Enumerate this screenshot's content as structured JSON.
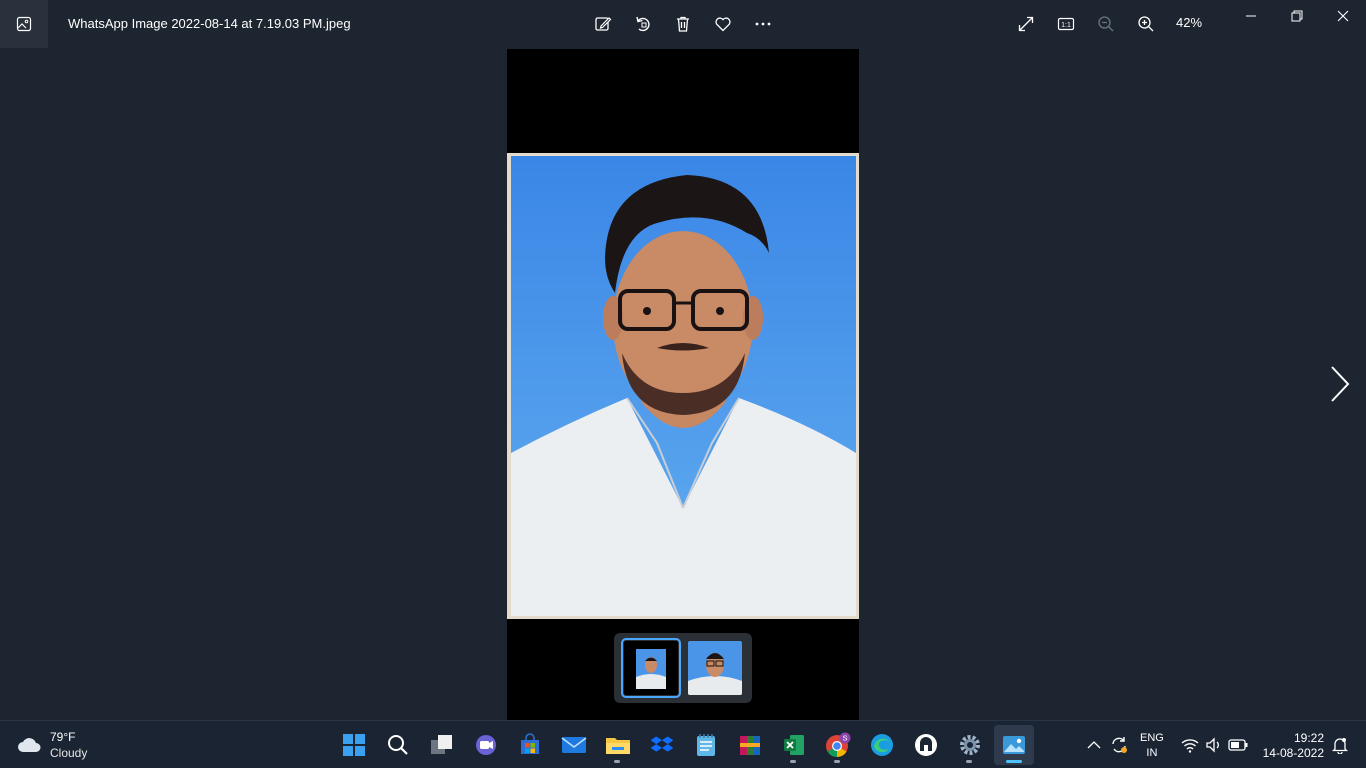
{
  "window": {
    "title": "WhatsApp Image 2022-08-14 at 7.19.03 PM.jpeg",
    "zoom": "42%"
  },
  "toolbar": {
    "icons": [
      "edit-image-icon",
      "rotate-icon",
      "delete-icon",
      "favorite-icon",
      "more-icon"
    ],
    "right_icons": [
      "fullscreen-icon",
      "actual-size-icon",
      "zoom-out-icon",
      "zoom-in-icon"
    ]
  },
  "window_controls": [
    "minimize-icon",
    "restore-icon",
    "close-icon"
  ],
  "filmstrip": {
    "selected_index": 0,
    "count": 2
  },
  "colors": {
    "background": "#1d2530",
    "photo_backdrop": "#3f8ee6",
    "accent": "#4cc2ff"
  },
  "taskbar": {
    "weather": {
      "temp": "79°F",
      "condition": "Cloudy"
    },
    "apps": [
      "start",
      "search",
      "task-view",
      "teams-chat",
      "microsoft-store",
      "mail",
      "file-explorer",
      "dropbox",
      "notepad",
      "winrar",
      "excel",
      "chrome",
      "edge",
      "app-store",
      "settings",
      "photos"
    ],
    "language": {
      "line1": "ENG",
      "line2": "IN"
    },
    "clock": {
      "time": "19:22",
      "date": "14-08-2022"
    },
    "chrome_badge": "S"
  }
}
